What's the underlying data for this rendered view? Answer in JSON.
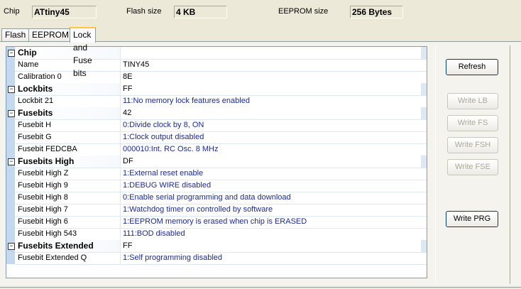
{
  "header": {
    "chip_label": "Chip",
    "chip_value": "ATtiny45",
    "flash_label": "Flash size",
    "flash_value": "4 KB",
    "eeprom_label": "EEPROM size",
    "eeprom_value": "256 Bytes"
  },
  "tabs": [
    "Flash",
    "EEPROM",
    "Lock and Fuse bits"
  ],
  "rows": [
    {
      "name": "Chip",
      "value": "",
      "header": true
    },
    {
      "name": "Name",
      "value": "TINY45"
    },
    {
      "name": "Calibration 0",
      "value": "8E"
    },
    {
      "name": "Lockbits",
      "value": "FF",
      "header": true
    },
    {
      "name": "Lockbit 21",
      "value": "11:No memory lock features enabled",
      "blue": true
    },
    {
      "name": "Fusebits",
      "value": "42",
      "header": true
    },
    {
      "name": "Fusebit H",
      "value": "0:Divide clock by 8, ON",
      "blue": true
    },
    {
      "name": "Fusebit G",
      "value": "1:Clock output disabled",
      "blue": true
    },
    {
      "name": "Fusebit FEDCBA",
      "value": "000010:Int. RC Osc. 8 MHz",
      "blue": true
    },
    {
      "name": "Fusebits High",
      "value": "DF",
      "header": true
    },
    {
      "name": "Fusebit High Z",
      "value": "1:External reset enable",
      "blue": true
    },
    {
      "name": "Fusebit High 9",
      "value": "1:DEBUG WIRE disabled",
      "blue": true
    },
    {
      "name": "Fusebit High 8",
      "value": "0:Enable serial programming and data download",
      "blue": true
    },
    {
      "name": "Fusebit High 7",
      "value": "1:Watchdog timer on controlled by software",
      "blue": true
    },
    {
      "name": "Fusebit High 6",
      "value": "1:EEPROM memory is erased when chip is ERASED",
      "blue": true
    },
    {
      "name": "Fusebit High 543",
      "value": "111:BOD disabled",
      "blue": true
    },
    {
      "name": "Fusebits Extended",
      "value": "FF",
      "header": true
    },
    {
      "name": "Fusebit Extended Q",
      "value": "1:Self programming disabled",
      "blue": true
    }
  ],
  "buttons": {
    "refresh": "Refresh",
    "write_lb": "Write LB",
    "write_fs": "Write FS",
    "write_fsh": "Write FSH",
    "write_fse": "Write FSE",
    "write_prg": "Write PRG"
  }
}
